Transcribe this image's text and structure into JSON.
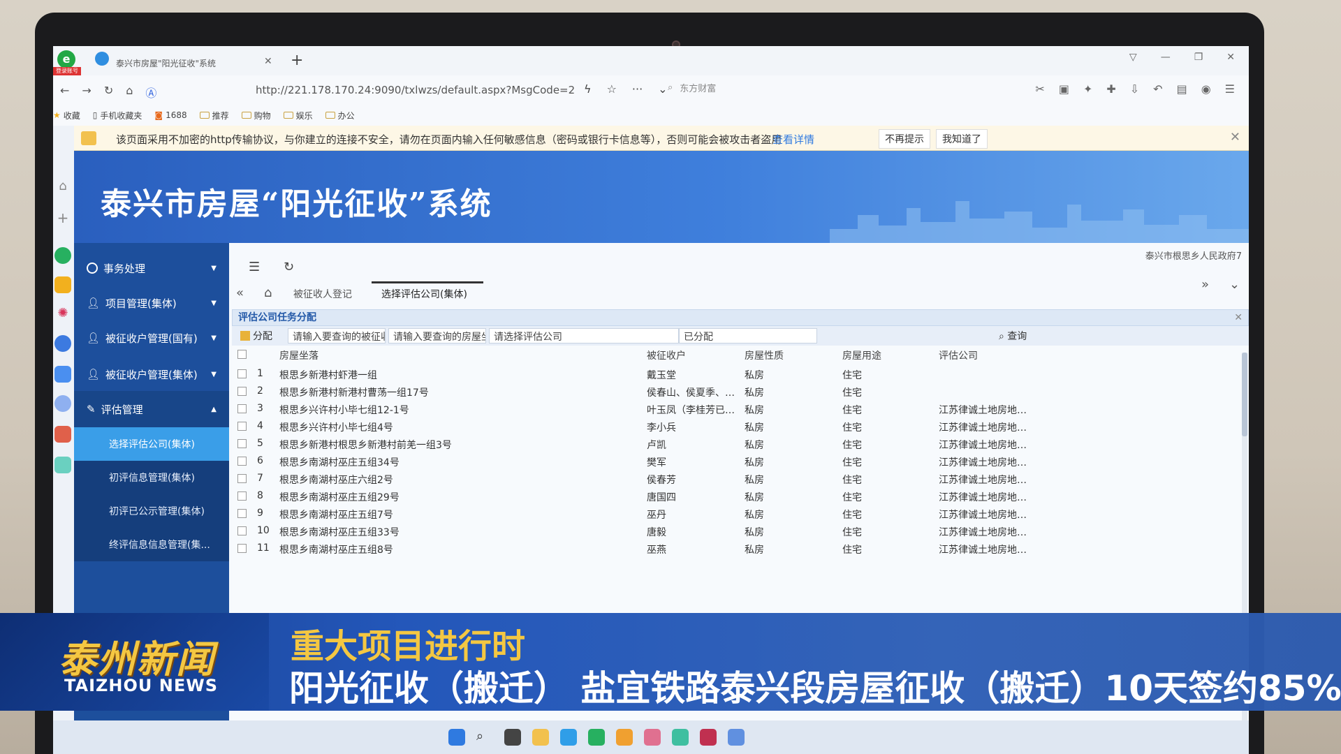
{
  "browser": {
    "logo_tag": "登录账号",
    "tab_title": "泰兴市房屋\"阳光征收\"系统",
    "url": "http://221.178.170.24:9090/txlwzs/default.aspx?MsgCode=2",
    "search_placeholder": "东方财富",
    "bookmarks": [
      {
        "label": "收藏"
      },
      {
        "label": "手机收藏夹"
      },
      {
        "label": "1688"
      },
      {
        "label": "推荐"
      },
      {
        "label": "购物"
      },
      {
        "label": "娱乐"
      },
      {
        "label": "办公"
      }
    ]
  },
  "warning": {
    "text": "该页面采用不加密的http传输协议，与你建立的连接不安全，请勿在页面内输入任何敏感信息（密码或银行卡信息等），否则可能会被攻击者盗用",
    "link": "查看详情",
    "dismiss": "不再提示",
    "ack": "我知道了"
  },
  "app": {
    "title": "泰兴市房屋“阳光征收”系统",
    "user": "泰兴市根思乡人民政府7"
  },
  "menu": {
    "items": [
      {
        "label": "事务处理"
      },
      {
        "label": "项目管理(集体)"
      },
      {
        "label": "被征收户管理(国有)"
      },
      {
        "label": "被征收户管理(集体)"
      },
      {
        "label": "评估管理"
      }
    ],
    "sub_items": [
      {
        "label": "选择评估公司(集体)"
      },
      {
        "label": "初评信息管理(集体)"
      },
      {
        "label": "初评已公示管理(集体)"
      },
      {
        "label": "终评信息信息管理(集..."
      }
    ]
  },
  "tabs": {
    "tab1": "被征收人登记",
    "tab2": "选择评估公司(集体)"
  },
  "panel": {
    "title": "评估公司任务分配",
    "assign_btn": "分配",
    "filter1": "请输入要查询的被征收",
    "filter2": "请输入要查询的房屋坐",
    "filter3": "请选择评估公司",
    "filter4": "已分配",
    "query": "查询"
  },
  "grid": {
    "headers": {
      "location": "房屋坐落",
      "owner": "被征收户",
      "nature": "房屋性质",
      "usage": "房屋用途",
      "company": "评估公司"
    },
    "rows": [
      {
        "no": "1",
        "location": "根思乡新港村虾港一组",
        "owner": "戴玉堂",
        "nature": "私房",
        "usage": "住宅",
        "company": ""
      },
      {
        "no": "2",
        "location": "根思乡新港村新港村曹荡一组17号",
        "owner": "侯春山、侯夏季、鞠...",
        "nature": "私房",
        "usage": "住宅",
        "company": ""
      },
      {
        "no": "3",
        "location": "根思乡兴许村小毕七组12-1号",
        "owner": "叶玉凤（李桂芳已亡...",
        "nature": "私房",
        "usage": "住宅",
        "company": "江苏律诚土地房地产..."
      },
      {
        "no": "4",
        "location": "根思乡兴许村小毕七组4号",
        "owner": "李小兵",
        "nature": "私房",
        "usage": "住宅",
        "company": "江苏律诚土地房地产..."
      },
      {
        "no": "5",
        "location": "根思乡新港村根思乡新港村前羌一组3号",
        "owner": "卢凯",
        "nature": "私房",
        "usage": "住宅",
        "company": "江苏律诚土地房地产..."
      },
      {
        "no": "6",
        "location": "根思乡南湖村巫庄五组34号",
        "owner": "樊军",
        "nature": "私房",
        "usage": "住宅",
        "company": "江苏律诚土地房地产..."
      },
      {
        "no": "7",
        "location": "根思乡南湖村巫庄六组2号",
        "owner": "侯春芳",
        "nature": "私房",
        "usage": "住宅",
        "company": "江苏律诚土地房地产..."
      },
      {
        "no": "8",
        "location": "根思乡南湖村巫庄五组29号",
        "owner": "唐国四",
        "nature": "私房",
        "usage": "住宅",
        "company": "江苏律诚土地房地产..."
      },
      {
        "no": "9",
        "location": "根思乡南湖村巫庄五组7号",
        "owner": "巫丹",
        "nature": "私房",
        "usage": "住宅",
        "company": "江苏律诚土地房地产..."
      },
      {
        "no": "10",
        "location": "根思乡南湖村巫庄五组33号",
        "owner": "唐毅",
        "nature": "私房",
        "usage": "住宅",
        "company": "江苏律诚土地房地产..."
      },
      {
        "no": "11",
        "location": "根思乡南湖村巫庄五组8号",
        "owner": "巫燕",
        "nature": "私房",
        "usage": "住宅",
        "company": "江苏律诚土地房地产..."
      }
    ]
  },
  "news": {
    "logo_cn": "泰州新闻",
    "logo_en": "TAIZHOU NEWS",
    "headline": "重大项目进行时",
    "subline": "阳光征收（搬迁） 盐宜铁路泰兴段房屋征收（搬迁）10天签约85%"
  },
  "colors": {
    "menu_bg": "#1d4f9c",
    "menu_active": "#3a9ee8",
    "banner": "#3f7fdc",
    "news_yellow": "#f4c742",
    "news_blue": "#1d52b8"
  }
}
